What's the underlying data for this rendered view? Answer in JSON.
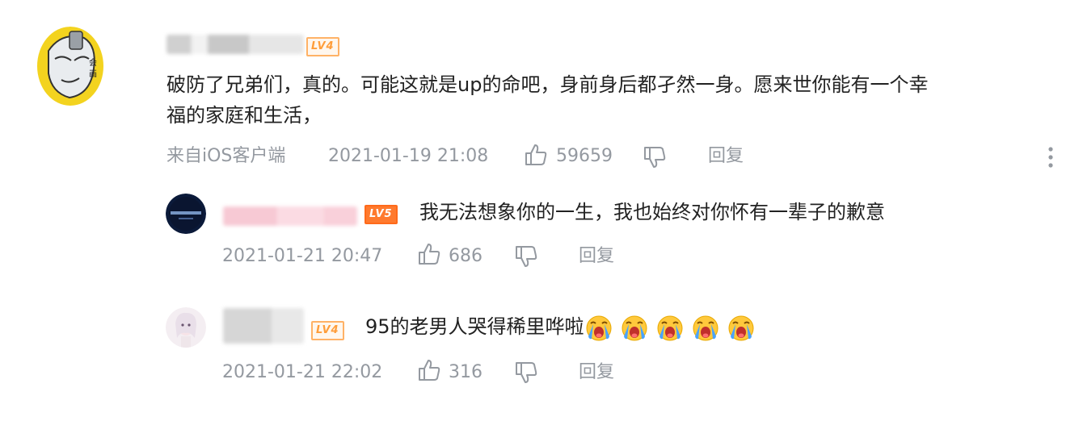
{
  "colors": {
    "meta": "#9499a0",
    "text": "#222222",
    "badge_orange": "#ff9d3a"
  },
  "comments": [
    {
      "badge": "LV4",
      "text_line1": "破防了兄弟们，真的。可能这就是up的命吧，身前身后都孑然一身。愿来世你能有一个幸",
      "text_line2": "福的家庭和生活，",
      "source": "来自iOS客户端",
      "time": "2021-01-19 21:08",
      "likes": "59659",
      "reply": "回复"
    }
  ],
  "replies": [
    {
      "badge": "LV5",
      "text": "我无法想象你的一生，我也始终对你怀有一辈子的歉意",
      "time": "2021-01-21 20:47",
      "likes": "686",
      "reply": "回复"
    },
    {
      "badge": "LV4",
      "text": "95的老男人哭得稀里哗啦",
      "emoji_icons": [
        "crying-emoji-icon",
        "crying-emoji-icon",
        "crying-emoji-icon",
        "crying-emoji-icon",
        "crying-emoji-icon"
      ],
      "time": "2021-01-21 22:02",
      "likes": "316",
      "reply": "回复"
    }
  ]
}
